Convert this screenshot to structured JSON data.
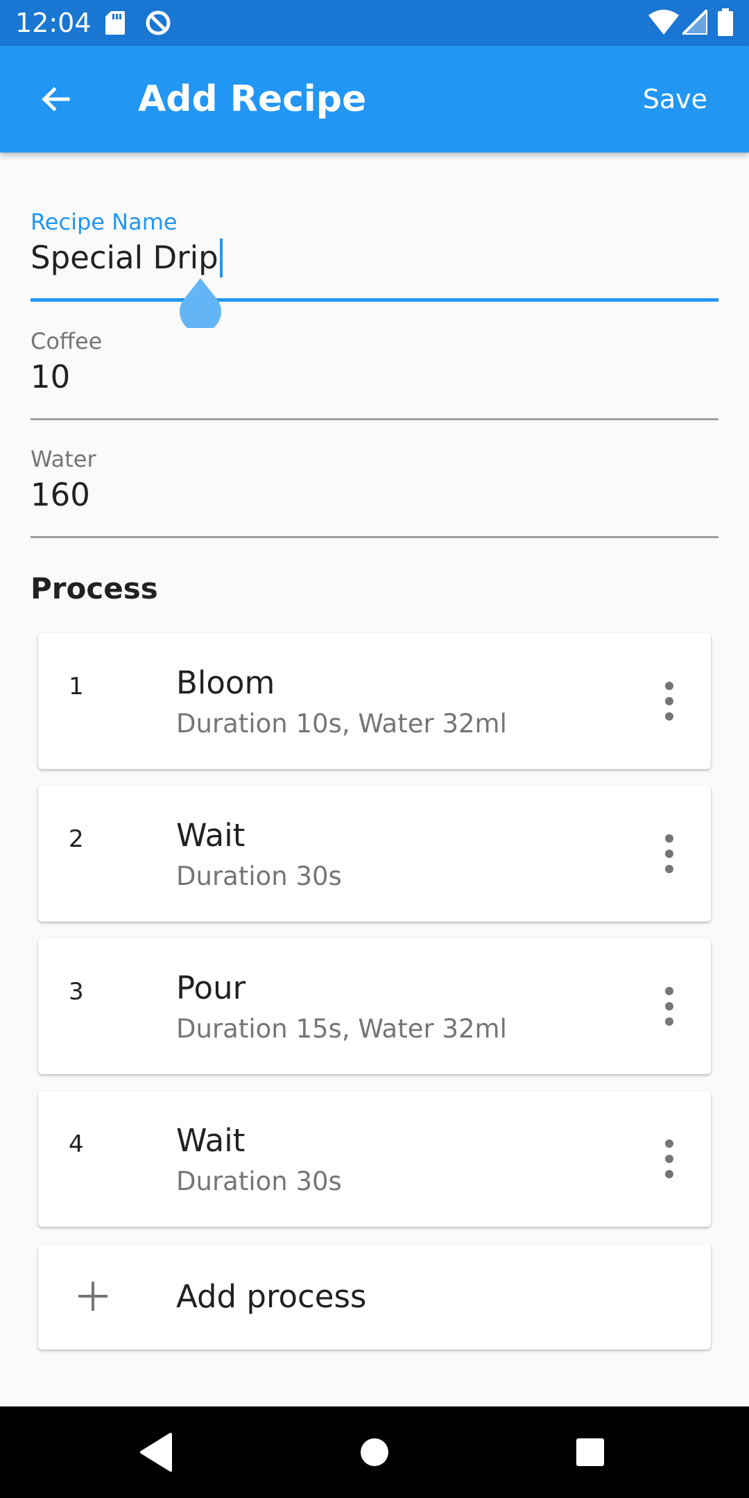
{
  "status_bar": {
    "time": "12:04",
    "icons": [
      "sd-card-icon",
      "sync-icon",
      "wifi-icon",
      "signal-icon",
      "battery-icon"
    ]
  },
  "app_bar": {
    "back_icon": "arrow-left-icon",
    "title": "Add Recipe",
    "save_label": "Save",
    "color": "#2196f3"
  },
  "form": {
    "recipe_name": {
      "label": "Recipe Name",
      "value": "Special Drip",
      "focused": true
    },
    "coffee": {
      "label": "Coffee",
      "value": "10"
    },
    "water": {
      "label": "Water",
      "value": "160"
    }
  },
  "process": {
    "title": "Process",
    "steps": [
      {
        "number": "1",
        "title": "Bloom",
        "subtitle": "Duration 10s, Water 32ml"
      },
      {
        "number": "2",
        "title": "Wait",
        "subtitle": "Duration 30s"
      },
      {
        "number": "3",
        "title": "Pour",
        "subtitle": "Duration 15s, Water 32ml"
      },
      {
        "number": "4",
        "title": "Wait",
        "subtitle": "Duration 30s"
      }
    ],
    "add_label": "Add process"
  },
  "nav_bar": {
    "icons": [
      "back-triangle-icon",
      "home-circle-icon",
      "recents-square-icon"
    ]
  }
}
